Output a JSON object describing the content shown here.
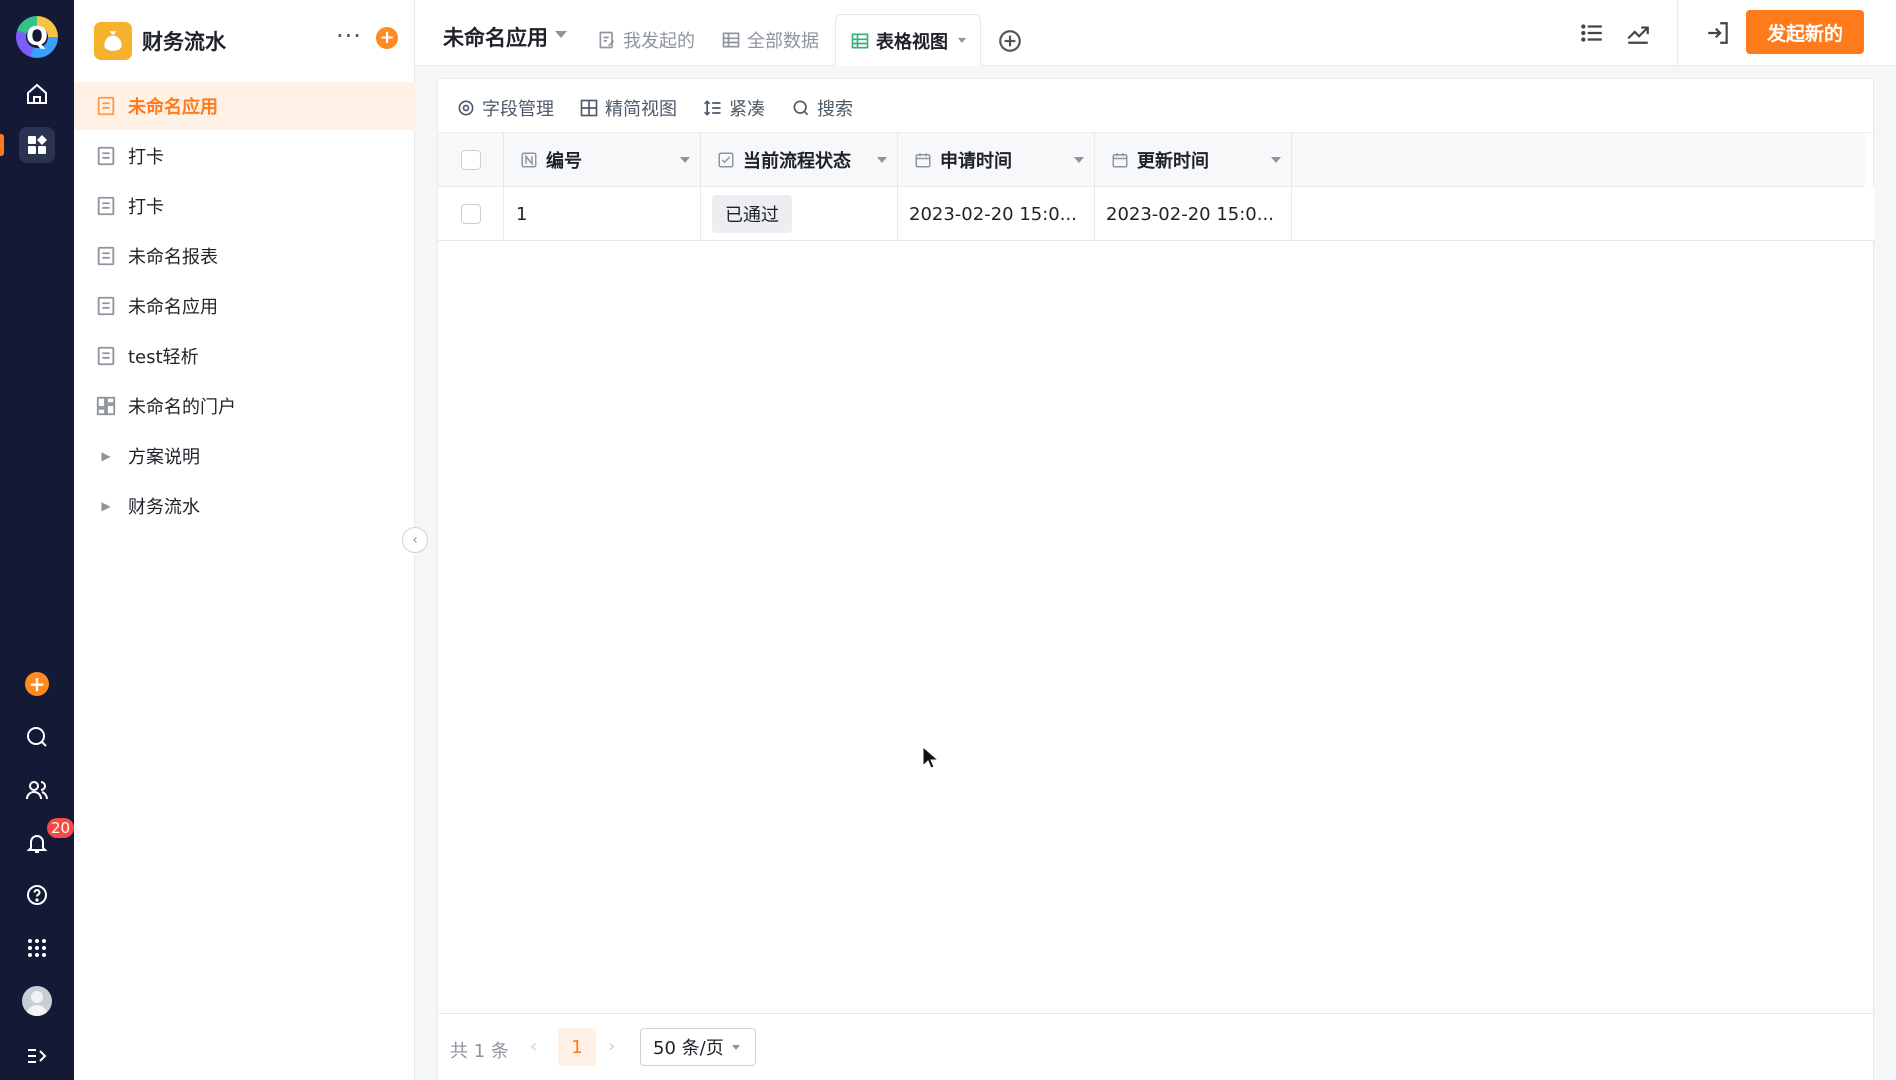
{
  "rail": {
    "logo_letter": "Q",
    "notification_count": "20",
    "icons": [
      "home-icon",
      "apps-icon",
      "add-icon",
      "search-icon",
      "contacts-icon",
      "bell-icon",
      "help-icon",
      "grid-icon",
      "avatar",
      "expand-icon"
    ]
  },
  "sidebar": {
    "title": "财务流水",
    "items": [
      {
        "label": "未命名应用",
        "icon": "form-icon",
        "active": true
      },
      {
        "label": "打卡",
        "icon": "form-icon"
      },
      {
        "label": "打卡",
        "icon": "form-icon"
      },
      {
        "label": "未命名报表",
        "icon": "form-icon"
      },
      {
        "label": "未命名应用",
        "icon": "form-icon"
      },
      {
        "label": "test轻析",
        "icon": "form-icon"
      },
      {
        "label": "未命名的门户",
        "icon": "portal-icon"
      },
      {
        "label": "方案说明",
        "icon": "caret-right-icon"
      },
      {
        "label": "财务流水",
        "icon": "caret-right-icon"
      }
    ]
  },
  "topbar": {
    "app_title": "未命名应用",
    "tabs": [
      {
        "label": "我发起的",
        "icon": "edit-icon"
      },
      {
        "label": "全部数据",
        "icon": "table-icon"
      },
      {
        "label": "表格视图",
        "icon": "table-green-icon",
        "active": true
      }
    ],
    "primary_button": "发起新的"
  },
  "toolbar": {
    "field_manage": "字段管理",
    "compact_view": "精简视图",
    "density": "紧凑",
    "search": "搜索"
  },
  "table": {
    "columns": [
      "编号",
      "当前流程状态",
      "申请时间",
      "更新时间"
    ],
    "rows": [
      {
        "id": "1",
        "status": "已通过",
        "apply_time": "2023-02-20 15:0...",
        "update_time": "2023-02-20 15:0..."
      }
    ]
  },
  "pager": {
    "total": "共 1 条",
    "prev": "‹",
    "current": "1",
    "next": "›",
    "page_size": "50 条/页"
  },
  "colors": {
    "accent": "#ff7a1a",
    "rail_bg": "#141a35",
    "active_bg": "#fff1e6"
  }
}
